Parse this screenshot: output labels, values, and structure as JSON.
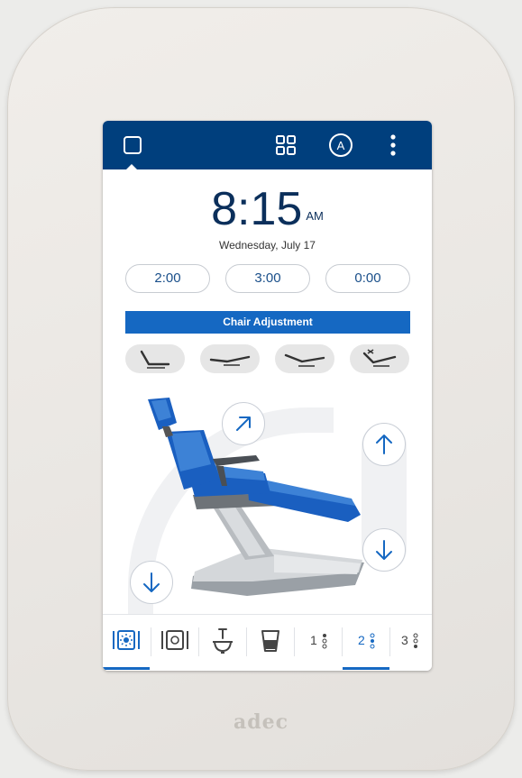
{
  "clock": {
    "time": "8:15",
    "ampm": "AM",
    "date": "Wednesday, July 17"
  },
  "timers": [
    "2:00",
    "3:00",
    "0:00"
  ],
  "chair": {
    "title": "Chair Adjustment"
  },
  "presets": [
    "preset-upright-icon",
    "preset-supine-icon",
    "preset-recline-icon",
    "preset-trendelenburg-icon"
  ],
  "bottom_nav": {
    "items": [
      "Light",
      "Light off",
      "Cuspidor",
      "Cup fill",
      "1",
      "2",
      "3"
    ],
    "active_index": 5
  },
  "brand": {
    "name": "adec"
  },
  "colors": {
    "topbar": "#003f7d",
    "accent": "#1568c2",
    "chair_upholstery": "#1a5fc0"
  },
  "topbar": {
    "account_letter": "A"
  }
}
